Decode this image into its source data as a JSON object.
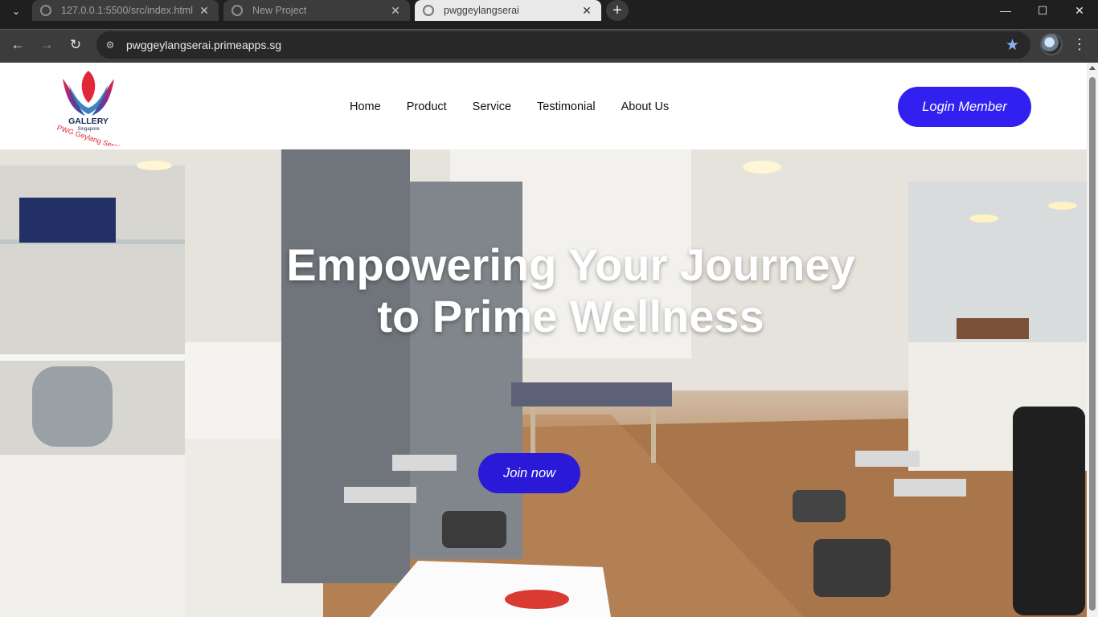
{
  "browser": {
    "tabs": [
      {
        "title": "127.0.0.1:5500/src/index.html",
        "active": false
      },
      {
        "title": "New Project",
        "active": false
      },
      {
        "title": "pwggeylangserai",
        "active": true
      }
    ],
    "url": "pwggeylangserai.primeapps.sg",
    "icons": {
      "tab_menu": "chevron-down-icon",
      "back": "back-arrow-icon",
      "forward": "forward-arrow-icon",
      "reload": "reload-icon",
      "site_info": "site-settings-icon",
      "bookmark": "star-icon",
      "menu": "kebab-menu-icon"
    },
    "accent_color": "#8ab4f8"
  },
  "logo": {
    "line1": "GALLERY",
    "line2": "Singapore",
    "line3": "PWG Geylang Serai"
  },
  "nav": {
    "items": [
      "Home",
      "Product",
      "Service",
      "Testimonial",
      "About Us"
    ]
  },
  "login_button": "Login Member",
  "hero": {
    "title_line1": "Empowering Your Journey",
    "title_line2": "to Prime Wellness",
    "cta": "Join now"
  },
  "colors": {
    "primary_button": "#3120f0",
    "hero_text": "#ffffff"
  }
}
